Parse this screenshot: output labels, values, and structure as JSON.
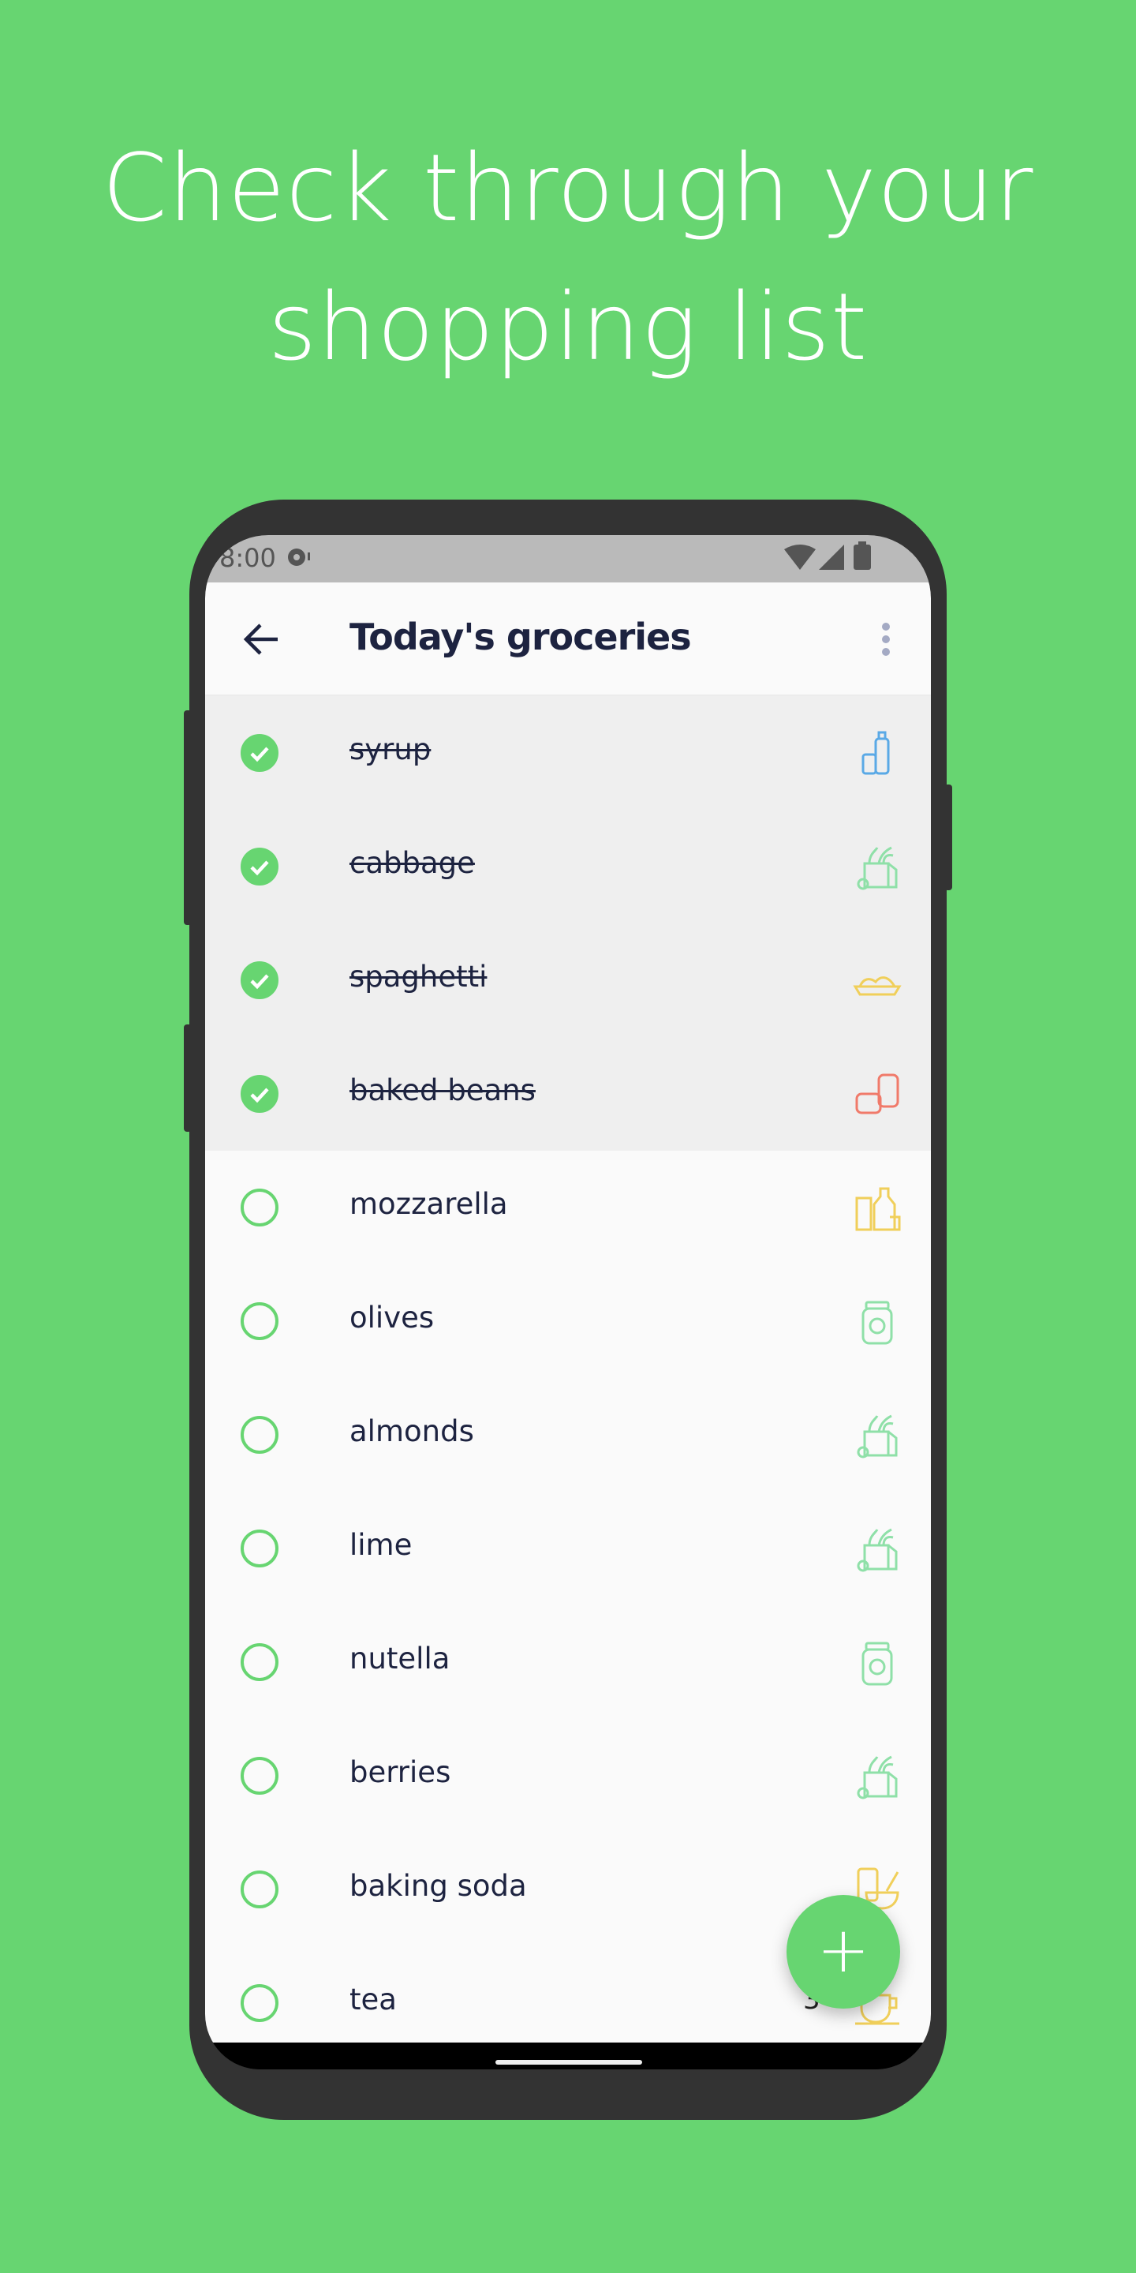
{
  "headline": [
    "Check through your",
    "shopping list"
  ],
  "status_bar": {
    "time": "8:00"
  },
  "header": {
    "title": "Today's groceries",
    "back_icon": "arrow-left-icon",
    "menu_icon": "more-vertical-icon"
  },
  "colors": {
    "brand": "#67d571",
    "drinks": "#5aa9e6",
    "produce": "#8fe0a8",
    "pantry": "#f0cf5a",
    "canned": "#f07a6a"
  },
  "items": [
    {
      "label": "syrup",
      "checked": true,
      "icon": "drinks",
      "color": "#5aa9e6"
    },
    {
      "label": "cabbage",
      "checked": true,
      "icon": "produce",
      "color": "#8fe0a8"
    },
    {
      "label": "spaghetti",
      "checked": true,
      "icon": "pasta",
      "color": "#f0cf5a"
    },
    {
      "label": "baked beans",
      "checked": true,
      "icon": "canned",
      "color": "#f07a6a"
    },
    {
      "label": "mozzarella",
      "checked": false,
      "icon": "dairy",
      "color": "#f0cf5a"
    },
    {
      "label": "olives",
      "checked": false,
      "icon": "jar",
      "color": "#8fe0a8"
    },
    {
      "label": "almonds",
      "checked": false,
      "icon": "produce",
      "color": "#8fe0a8"
    },
    {
      "label": "lime",
      "checked": false,
      "icon": "produce",
      "color": "#8fe0a8"
    },
    {
      "label": "nutella",
      "checked": false,
      "icon": "jar",
      "color": "#8fe0a8"
    },
    {
      "label": "berries",
      "checked": false,
      "icon": "produce",
      "color": "#8fe0a8"
    },
    {
      "label": "baking soda",
      "checked": false,
      "icon": "baking",
      "color": "#f0cf5a"
    },
    {
      "label": "tea",
      "checked": false,
      "icon": "tea",
      "color": "#f0cf5a",
      "quantity": "3"
    }
  ],
  "fab": {
    "label": "+"
  }
}
